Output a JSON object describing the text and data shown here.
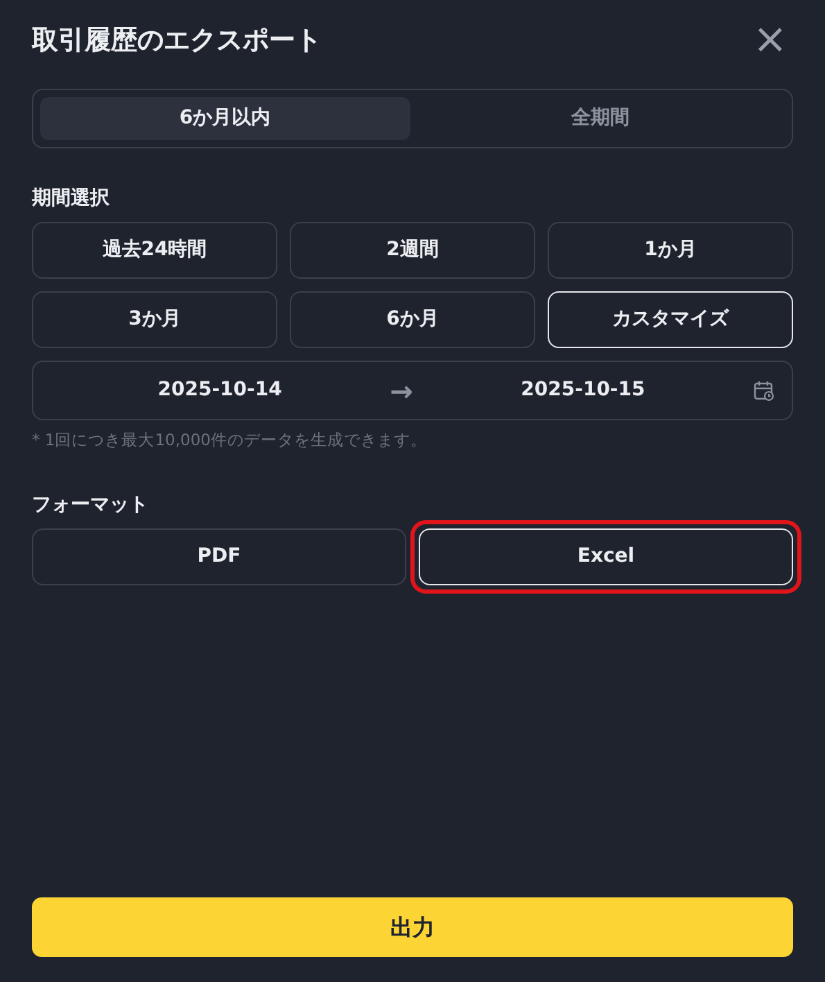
{
  "title": "取引履歴のエクスポート",
  "close": "×",
  "tabs": [
    {
      "label": "6か月以内",
      "selected": true
    },
    {
      "label": "全期間",
      "selected": false
    }
  ],
  "period": {
    "label": "期間選択",
    "options": [
      {
        "label": "過去24時間",
        "selected": false
      },
      {
        "label": "2週間",
        "selected": false
      },
      {
        "label": "1か月",
        "selected": false
      },
      {
        "label": "3か月",
        "selected": false
      },
      {
        "label": "6か月",
        "selected": false
      },
      {
        "label": "カスタマイズ",
        "selected": true
      }
    ],
    "start": "2025-10-14",
    "arrow": "→",
    "end": "2025-10-15",
    "note": "* 1回につき最大10,000件のデータを生成できます。"
  },
  "format": {
    "label": "フォーマット",
    "options": [
      {
        "label": "PDF",
        "selected": false,
        "highlighted": false
      },
      {
        "label": "Excel",
        "selected": true,
        "highlighted": true
      }
    ]
  },
  "submit": "出力"
}
